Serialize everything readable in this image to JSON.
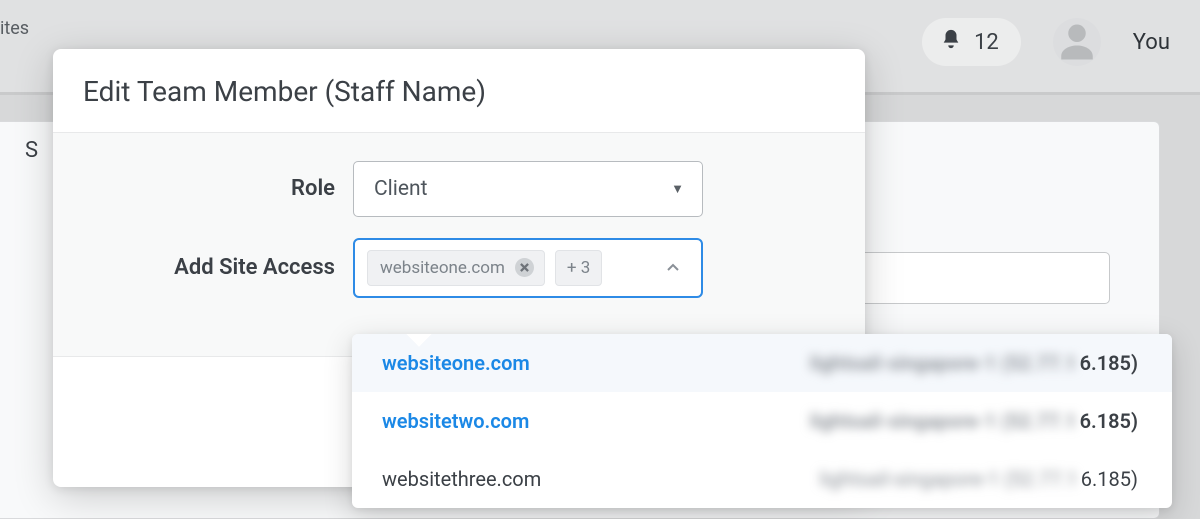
{
  "appbar": {
    "left_fragment": "ites",
    "notification_count": "12",
    "user_label": "You"
  },
  "bg": {
    "s_fragment": "S"
  },
  "modal": {
    "title": "Edit Team Member (Staff Name)",
    "role_label": "Role",
    "role_value": "Client",
    "site_access_label": "Add Site Access",
    "tag_value": "websiteone.com",
    "overflow_label": "+ 3"
  },
  "dropdown": {
    "rows": [
      {
        "site": "websiteone.com",
        "meta_blur": "lightsail-singapore-1 (52.77.1",
        "meta_tail": "6.185)",
        "selected": true,
        "bold": true
      },
      {
        "site": "websitetwo.com",
        "meta_blur": "lightsail-singapore-1 (52.77.1",
        "meta_tail": "6.185)",
        "selected": true,
        "bold": true
      },
      {
        "site": "websitethree.com",
        "meta_blur": "lightsail-singapore-1 (52.77.1",
        "meta_tail": "6.185)",
        "selected": false,
        "bold": false
      }
    ]
  }
}
